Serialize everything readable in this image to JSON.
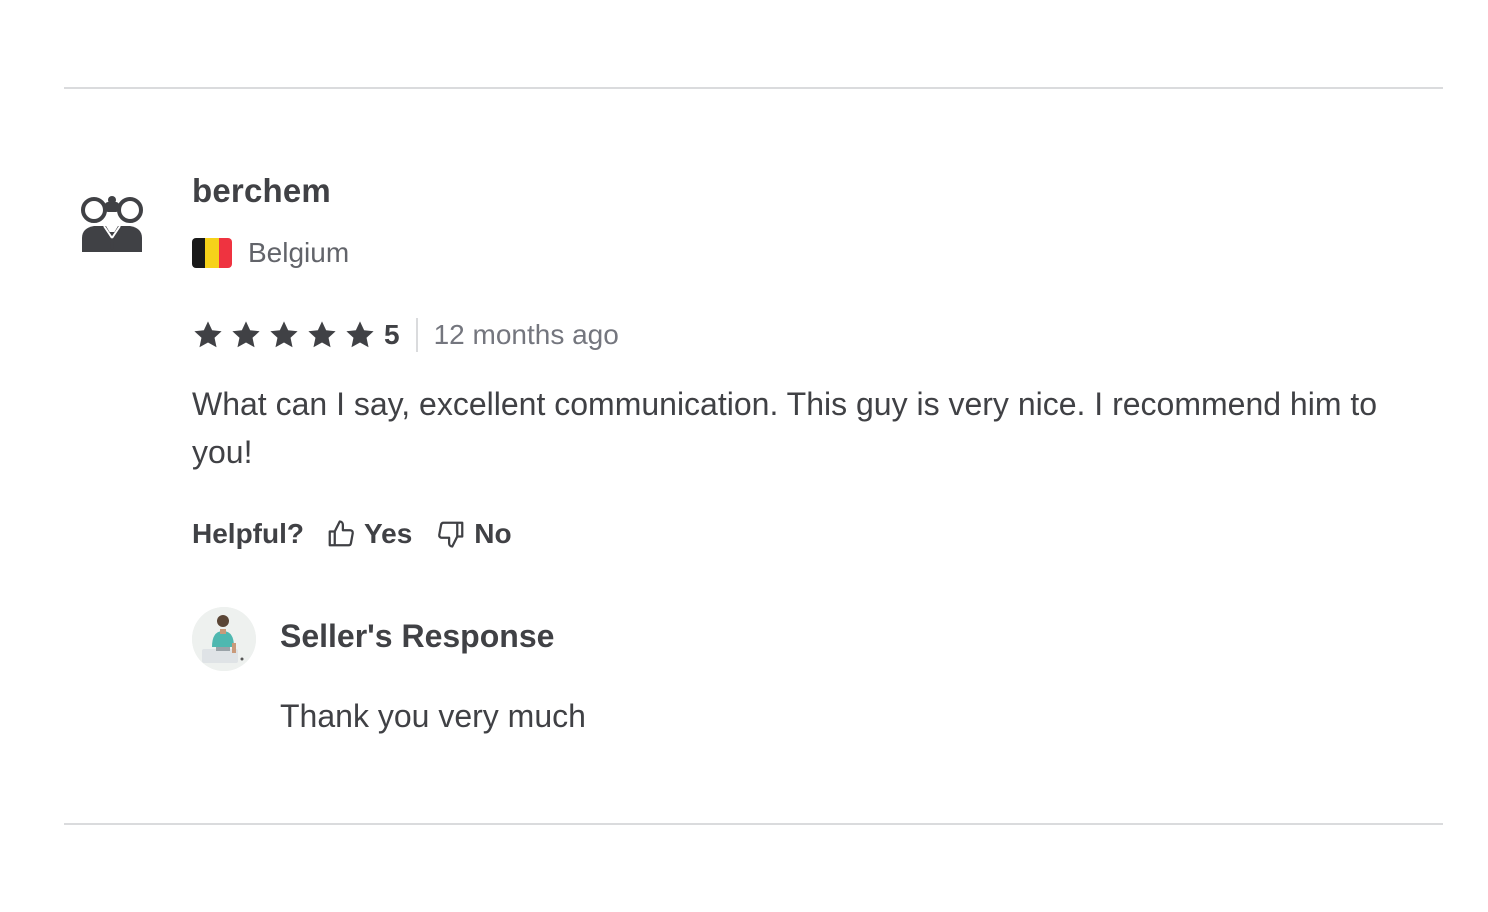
{
  "review": {
    "reviewer": {
      "name": "berchem",
      "avatar_icon": "binoculars-spy-icon",
      "country": "Belgium",
      "flag_colors": [
        "#1a1a1a",
        "#f6d21a",
        "#ef3340"
      ]
    },
    "rating": {
      "stars": 5,
      "value": "5"
    },
    "time_ago": "12 months ago",
    "text": "What can I say, excellent communication. This guy is very nice. I recommend him to you!",
    "helpful": {
      "label": "Helpful?",
      "yes_label": "Yes",
      "no_label": "No"
    },
    "seller_response": {
      "title": "Seller's Response",
      "text": "Thank you very much"
    }
  },
  "colors": {
    "text_primary": "#404145",
    "text_secondary": "#62646a",
    "divider": "#dadbdd"
  }
}
